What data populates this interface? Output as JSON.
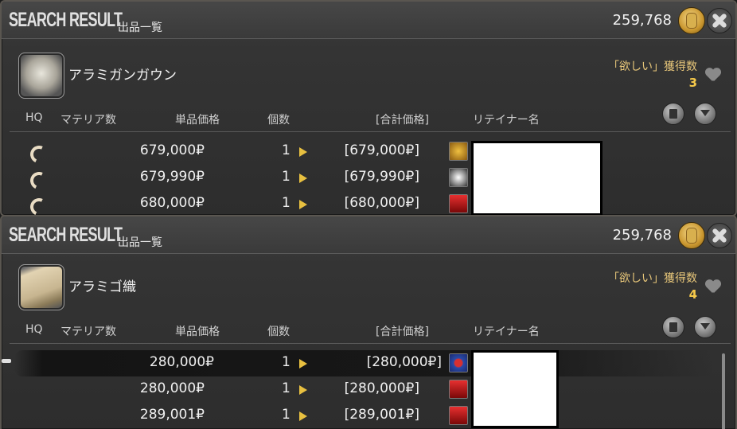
{
  "currency_symbol": "₽",
  "panels": [
    {
      "title": "SEARCH RESULT",
      "subtitle": "出品一覧",
      "gil": "259,768",
      "item_name": "アラミガンガウン",
      "want_label": "「欲しい」獲得数",
      "want_count": "3",
      "columns": {
        "hq": "HQ",
        "materia": "マテリア数",
        "unit_price": "単品価格",
        "quantity": "個数",
        "total": "[合計価格]",
        "retainer": "リテイナー名"
      },
      "rows": [
        {
          "hq": true,
          "price": "679,000₽",
          "qty": "1",
          "total": "[679,000₽]",
          "city_icon": "scales-icon"
        },
        {
          "hq": true,
          "price": "679,990₽",
          "qty": "1",
          "total": "[679,990₽]",
          "city_icon": "swirl-icon"
        },
        {
          "hq": true,
          "price": "680,000₽",
          "qty": "1",
          "total": "[680,000₽]",
          "city_icon": "red-crest-icon"
        }
      ]
    },
    {
      "title": "SEARCH RESULT",
      "subtitle": "出品一覧",
      "gil": "259,768",
      "item_name": "アラミゴ織",
      "want_label": "「欲しい」獲得数",
      "want_count": "4",
      "columns": {
        "hq": "HQ",
        "materia": "マテリア数",
        "unit_price": "単品価格",
        "quantity": "個数",
        "total": "[合計価格]",
        "retainer": "リテイナー名"
      },
      "rows": [
        {
          "hq": false,
          "selected": true,
          "price": "280,000₽",
          "qty": "1",
          "total": "[280,000₽]",
          "city_icon": "blue-crest-icon"
        },
        {
          "hq": false,
          "price": "280,000₽",
          "qty": "1",
          "total": "[280,000₽]",
          "city_icon": "red-crest-icon"
        },
        {
          "hq": false,
          "price": "289,001₽",
          "qty": "1",
          "total": "[289,001₽]",
          "city_icon": "red-crest-icon"
        }
      ]
    }
  ],
  "colors": {
    "accent_gold": "#e8c77a",
    "want_count": "#f5c84a",
    "arrow": "#e8c040"
  }
}
